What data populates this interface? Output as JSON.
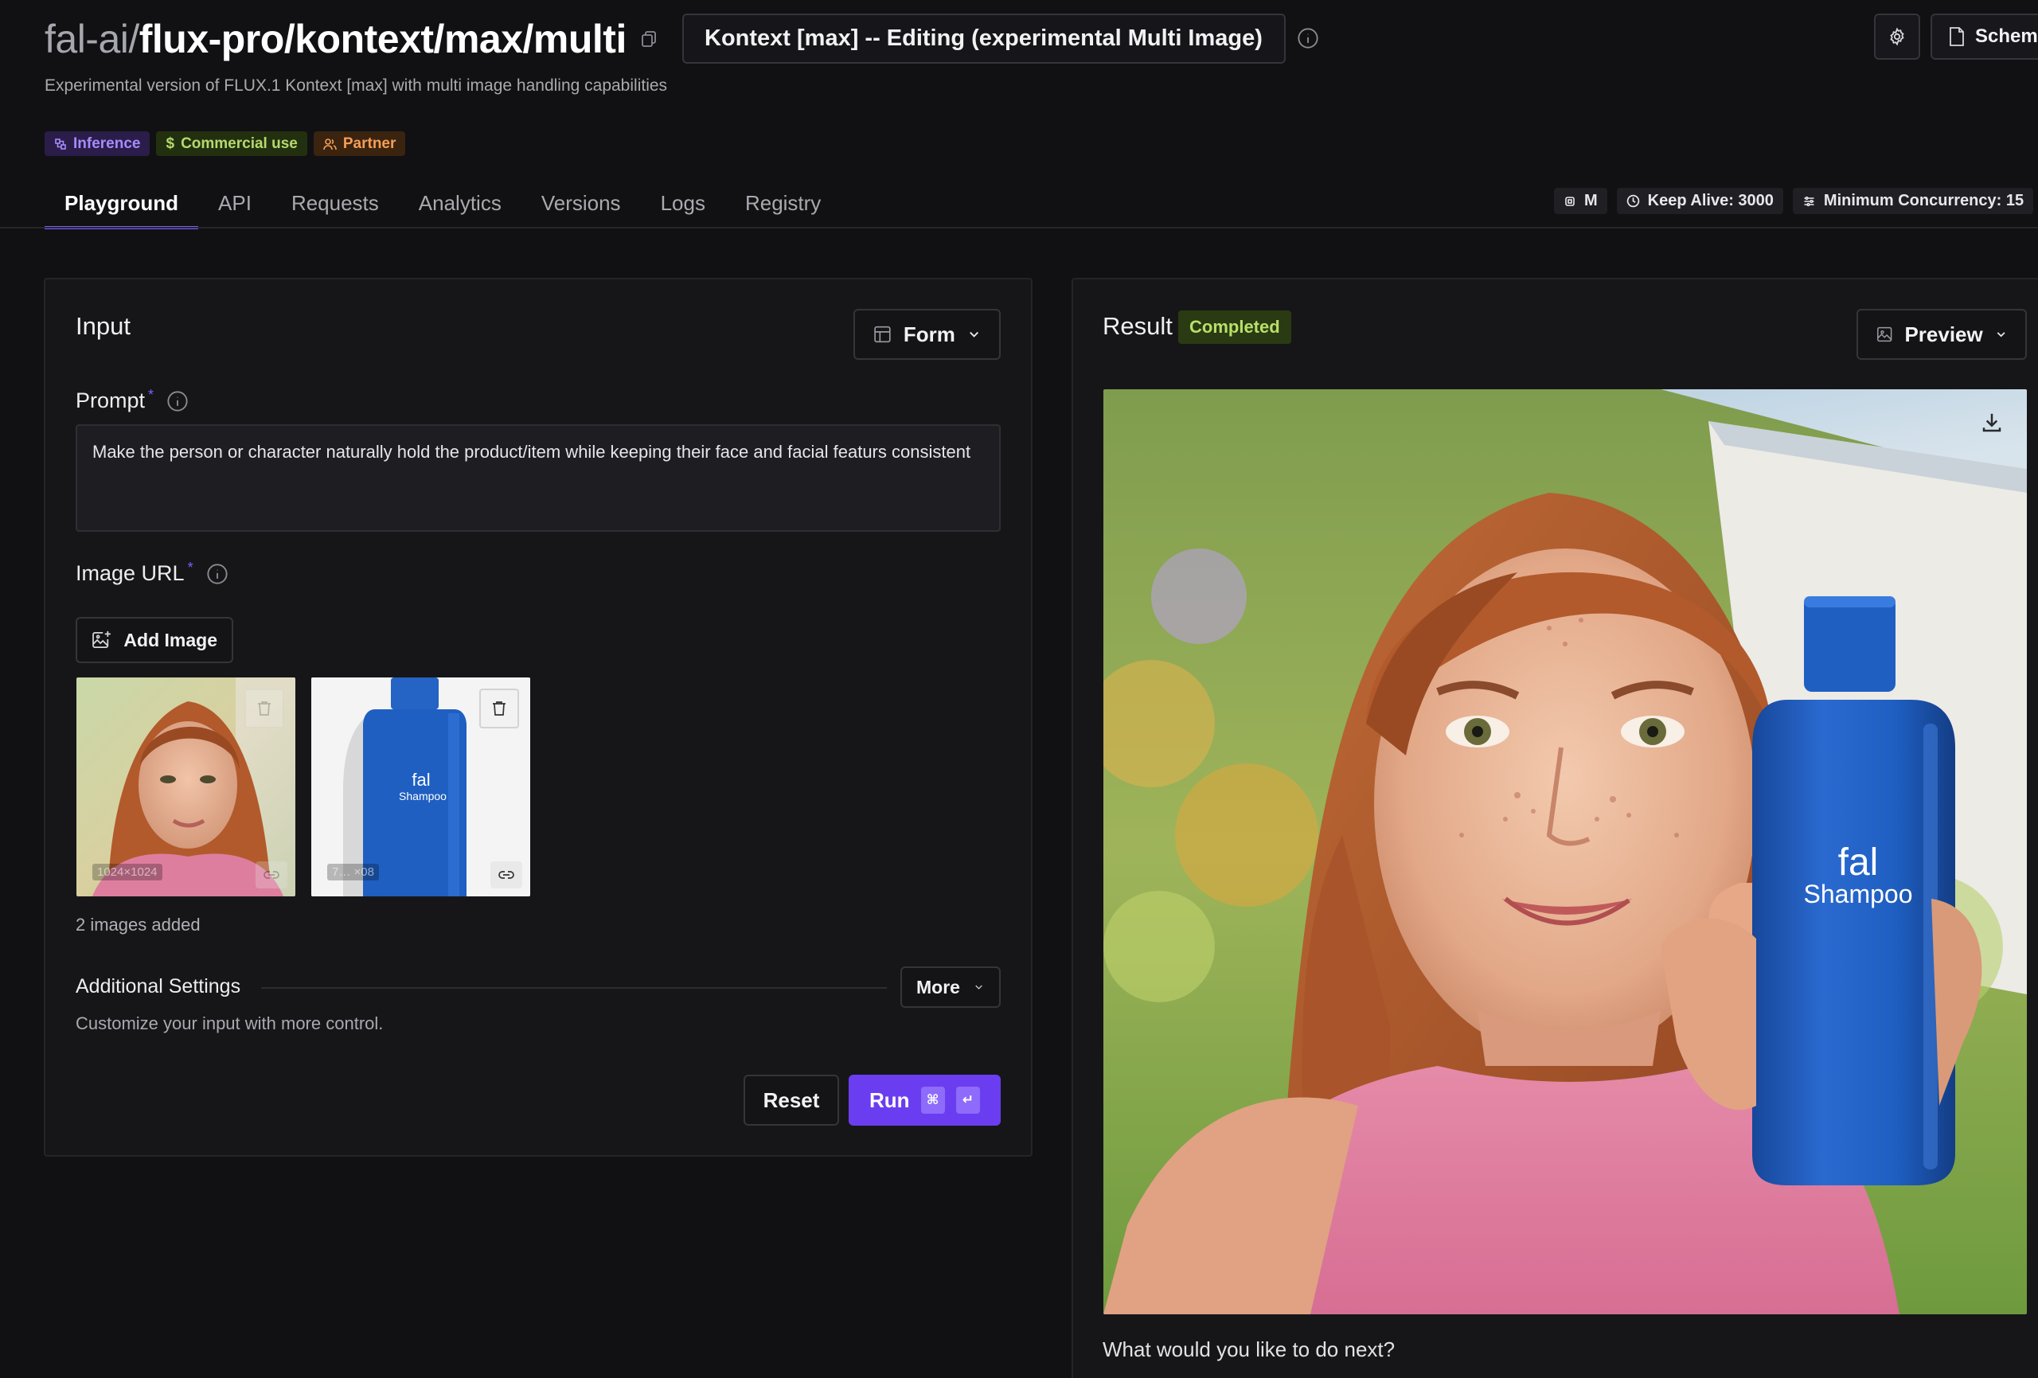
{
  "header": {
    "namespace": "fal-ai/",
    "model_path": "flux-pro/kontext/max/multi",
    "variant_select": "Kontext [max] -- Editing (experimental Multi Image)",
    "subtitle": "Experimental version of FLUX.1 Kontext [max] with multi image handling capabilities",
    "schema_label": "Schema"
  },
  "badges": [
    {
      "label": "Inference",
      "icon": "inference-icon"
    },
    {
      "label": "Commercial use",
      "icon": "dollar-icon"
    },
    {
      "label": "Partner",
      "icon": "users-icon"
    }
  ],
  "tabs": [
    {
      "label": "Playground",
      "active": true
    },
    {
      "label": "API"
    },
    {
      "label": "Requests"
    },
    {
      "label": "Analytics"
    },
    {
      "label": "Versions"
    },
    {
      "label": "Logs"
    },
    {
      "label": "Registry"
    }
  ],
  "chips": {
    "machine": "M",
    "keep_alive": "Keep Alive: 3000",
    "min_concurrency": "Minimum Concurrency: 15"
  },
  "input": {
    "title": "Input",
    "mode_select": "Form",
    "prompt_label": "Prompt",
    "required_mark": "*",
    "prompt_value": "Make the person or character naturally hold the product/item while keeping their face and facial featurs consistent",
    "image_url_label": "Image URL",
    "add_image_label": "Add Image",
    "thumb1_meta": "1024×1024",
    "thumb2_meta": "7… ×08",
    "product_brand": "fal",
    "product_name": "Shampoo",
    "images_count": "2 images added",
    "additional_title": "Additional Settings",
    "more_label": "More",
    "additional_sub": "Customize your input with more control.",
    "reset_label": "Reset",
    "run_label": "Run",
    "run_kbd1": "⌘",
    "run_kbd2": "↵"
  },
  "result": {
    "title": "Result",
    "status": "Completed",
    "preview_select": "Preview",
    "product_brand": "fal",
    "product_name": "Shampoo",
    "next_prompt": "What would you like to do next?"
  },
  "colors": {
    "accent": "#6b3df0",
    "status_green": "#b8e06a",
    "bottle_blue": "#1f5fc2"
  }
}
